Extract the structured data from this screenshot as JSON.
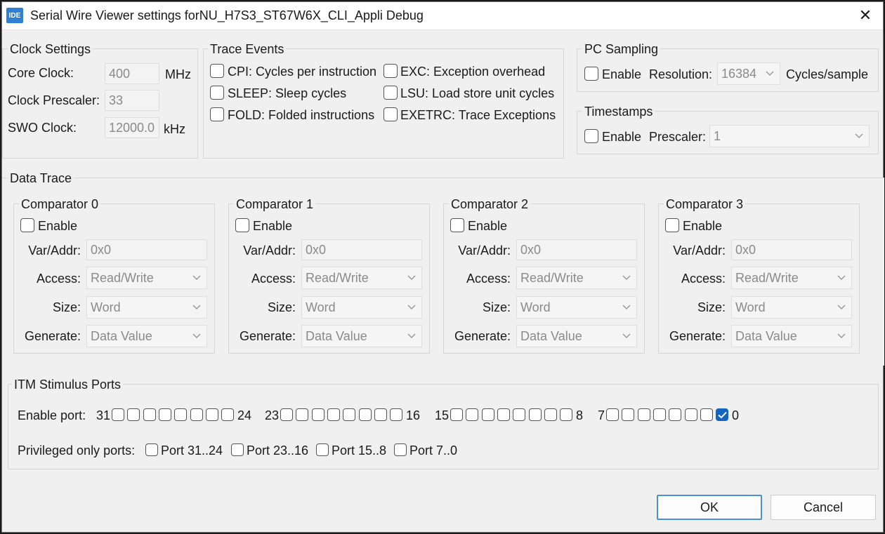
{
  "window": {
    "icon_label": "IDE",
    "title": "Serial Wire Viewer settings forNU_H7S3_ST67W6X_CLI_Appli Debug",
    "close_glyph": "✕"
  },
  "clock": {
    "legend": "Clock Settings",
    "core_label": "Core Clock:",
    "core_value": "400",
    "core_unit": "MHz",
    "prescaler_label": "Clock Prescaler:",
    "prescaler_value": "33",
    "swo_label": "SWO Clock:",
    "swo_value": "12000.0",
    "swo_unit": "kHz"
  },
  "trace_events": {
    "legend": "Trace Events",
    "items": [
      {
        "label": "CPI: Cycles per instruction",
        "checked": false
      },
      {
        "label": "SLEEP: Sleep cycles",
        "checked": false
      },
      {
        "label": "FOLD: Folded instructions",
        "checked": false
      },
      {
        "label": "EXC: Exception overhead",
        "checked": false
      },
      {
        "label": "LSU: Load store unit cycles",
        "checked": false
      },
      {
        "label": "EXETRC: Trace Exceptions",
        "checked": false
      }
    ]
  },
  "pc_sampling": {
    "legend": "PC Sampling",
    "enable_label": "Enable",
    "resolution_label": "Resolution:",
    "resolution_value": "16384",
    "unit": "Cycles/sample"
  },
  "timestamps": {
    "legend": "Timestamps",
    "enable_label": "Enable",
    "prescaler_label": "Prescaler:",
    "prescaler_value": "1"
  },
  "data_trace": {
    "legend": "Data Trace",
    "comparators": [
      {
        "title": "Comparator 0",
        "enable": "Enable",
        "var_label": "Var/Addr:",
        "var_value": "0x0",
        "access_label": "Access:",
        "access_value": "Read/Write",
        "size_label": "Size:",
        "size_value": "Word",
        "generate_label": "Generate:",
        "generate_value": "Data Value"
      },
      {
        "title": "Comparator 1",
        "enable": "Enable",
        "var_label": "Var/Addr:",
        "var_value": "0x0",
        "access_label": "Access:",
        "access_value": "Read/Write",
        "size_label": "Size:",
        "size_value": "Word",
        "generate_label": "Generate:",
        "generate_value": "Data Value"
      },
      {
        "title": "Comparator 2",
        "enable": "Enable",
        "var_label": "Var/Addr:",
        "var_value": "0x0",
        "access_label": "Access:",
        "access_value": "Read/Write",
        "size_label": "Size:",
        "size_value": "Word",
        "generate_label": "Generate:",
        "generate_value": "Data Value"
      },
      {
        "title": "Comparator 3",
        "enable": "Enable",
        "var_label": "Var/Addr:",
        "var_value": "0x0",
        "access_label": "Access:",
        "access_value": "Read/Write",
        "size_label": "Size:",
        "size_value": "Word",
        "generate_label": "Generate:",
        "generate_value": "Data Value"
      }
    ]
  },
  "itm": {
    "legend": "ITM Stimulus Ports",
    "enable_label": "Enable port:",
    "groups": [
      {
        "start": "31",
        "end": "24"
      },
      {
        "start": "23",
        "end": "16"
      },
      {
        "start": "15",
        "end": "8"
      },
      {
        "start": "7",
        "end": "0"
      }
    ],
    "checked_ports": [
      0
    ],
    "privileged_label": "Privileged only ports:",
    "privileged": [
      "Port 31..24",
      "Port 23..16",
      "Port 15..8",
      "Port 7..0"
    ]
  },
  "buttons": {
    "ok": "OK",
    "cancel": "Cancel"
  },
  "colors": {
    "check_accent": "#1565c0",
    "default_button_border": "#4a90d9"
  }
}
